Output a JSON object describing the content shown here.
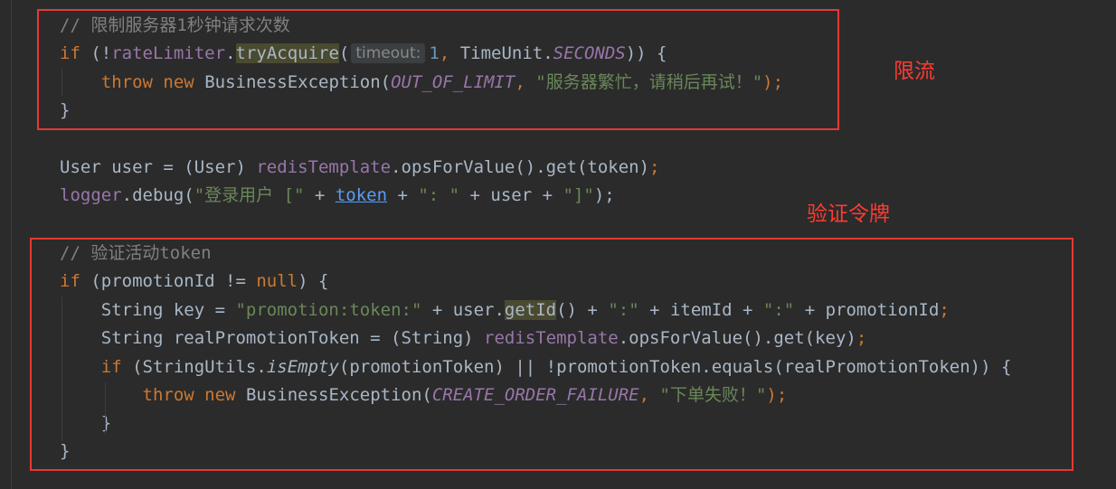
{
  "code": {
    "comment_limit": "// 限制服务器1秒钟请求次数",
    "if_kw": "if",
    "l2_a": " (!",
    "rate_limiter": "rateLimiter",
    "dot": ".",
    "try_acquire": "tryAcquire",
    "open_paren": "(",
    "hint_timeout": "timeout:",
    "one": "1",
    "comma": ",",
    "l2_b": " TimeUnit.",
    "seconds": "SECONDS",
    "l2_c": ")) {",
    "throw_kw": "throw",
    "new_kw": "new",
    "business_exception": " BusinessException(",
    "out_of_limit": "OUT_OF_LIMIT",
    "busy_msg": "\"服务器繁忙，请稍后再试！\"",
    "close_semicolon": ");",
    "close_brace": "}",
    "l5_a": "User user = (User) ",
    "redis_template": "redisTemplate",
    "l5_b": ".opsForValue().get(token)",
    "semicolon": ";",
    "logger": "logger",
    "l6_a": ".debug(",
    "login_user_str": "\"登录用户 [\"",
    "plus": " + ",
    "token": "token",
    "colon_str": "\": \"",
    "l6_b": " + user + ",
    "bracket_str": "\"]\"",
    "comment_token": "// 验证活动token",
    "l8_a": " (promotionId != ",
    "null_kw": "null",
    "l8_b": ") {",
    "l9_a": "String key = ",
    "promo_token_str": "\"promotion:token:\"",
    "l9_b": " + user.",
    "get_id": "getId",
    "l9_c": "() + ",
    "colon_only_str": "\":\"",
    "l9_d": " + itemId + ",
    "l9_e": " + promotionId",
    "l10_a": "String realPromotionToken = (String) ",
    "l10_b": ".opsForValue().get(key)",
    "l11_a": " (StringUtils.",
    "is_empty": "isEmpty",
    "l11_b": "(promotionToken) || !promotionToken.equals(realPromotionToken)) {",
    "create_order_failure": "CREATE_ORDER_FAILURE",
    "order_fail_msg": "\"下单失败！\""
  },
  "annotations": {
    "rate_limit_label": "限流",
    "verify_token_label": "验证令牌",
    "box_color": "#e53935"
  }
}
